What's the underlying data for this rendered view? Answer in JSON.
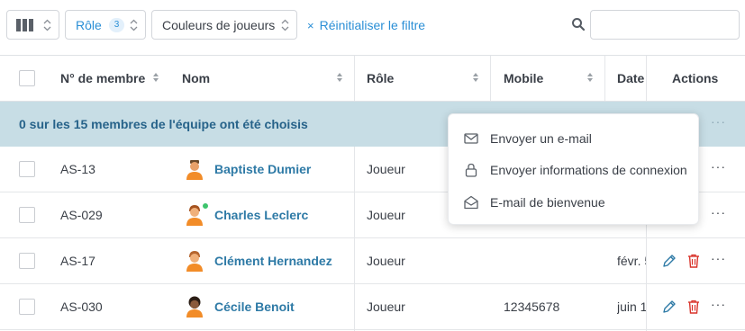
{
  "toolbar": {
    "columns_icon": "columns-icon",
    "role_filter": {
      "label": "Rôle",
      "count": "3"
    },
    "colors_filter": {
      "label": "Couleurs de joueurs"
    },
    "reset": {
      "icon": "×",
      "label": "Réinitialiser le filtre"
    },
    "search": {
      "icon": "search-icon",
      "placeholder": "",
      "value": ""
    }
  },
  "table": {
    "headers": {
      "member_no": "N° de membre",
      "name": "Nom",
      "role": "Rôle",
      "mobile": "Mobile",
      "date": "Date",
      "actions": "Actions"
    },
    "selection_text": "0 sur les 15 membres de l'équipe ont été choisis",
    "rows": [
      {
        "member_no": "AS-13",
        "name": "Baptiste Dumier",
        "role": "Joueur",
        "mobile": "",
        "date": "",
        "online": false
      },
      {
        "member_no": "AS-029",
        "name": "Charles Leclerc",
        "role": "Joueur",
        "mobile": "",
        "date": "",
        "online": true
      },
      {
        "member_no": "AS-17",
        "name": "Clément Hernandez",
        "role": "Joueur",
        "mobile": "",
        "date": "févr. 5",
        "online": false
      },
      {
        "member_no": "AS-030",
        "name": "Cécile Benoit",
        "role": "Joueur",
        "mobile": "12345678",
        "date": "juin 1",
        "online": false
      }
    ]
  },
  "dropdown": {
    "items": [
      {
        "label": "Envoyer un e-mail",
        "icon": "envelope-icon"
      },
      {
        "label": "Envoyer informations de connexion",
        "icon": "lock-icon"
      },
      {
        "label": "E-mail de bienvenue",
        "icon": "envelope-open-icon"
      }
    ]
  },
  "colors": {
    "accent": "#2b8fd6",
    "selection_bar": "#c7dde5",
    "name_link": "#2e7aa6",
    "delete": "#d9342b",
    "online": "#3ec46d"
  }
}
